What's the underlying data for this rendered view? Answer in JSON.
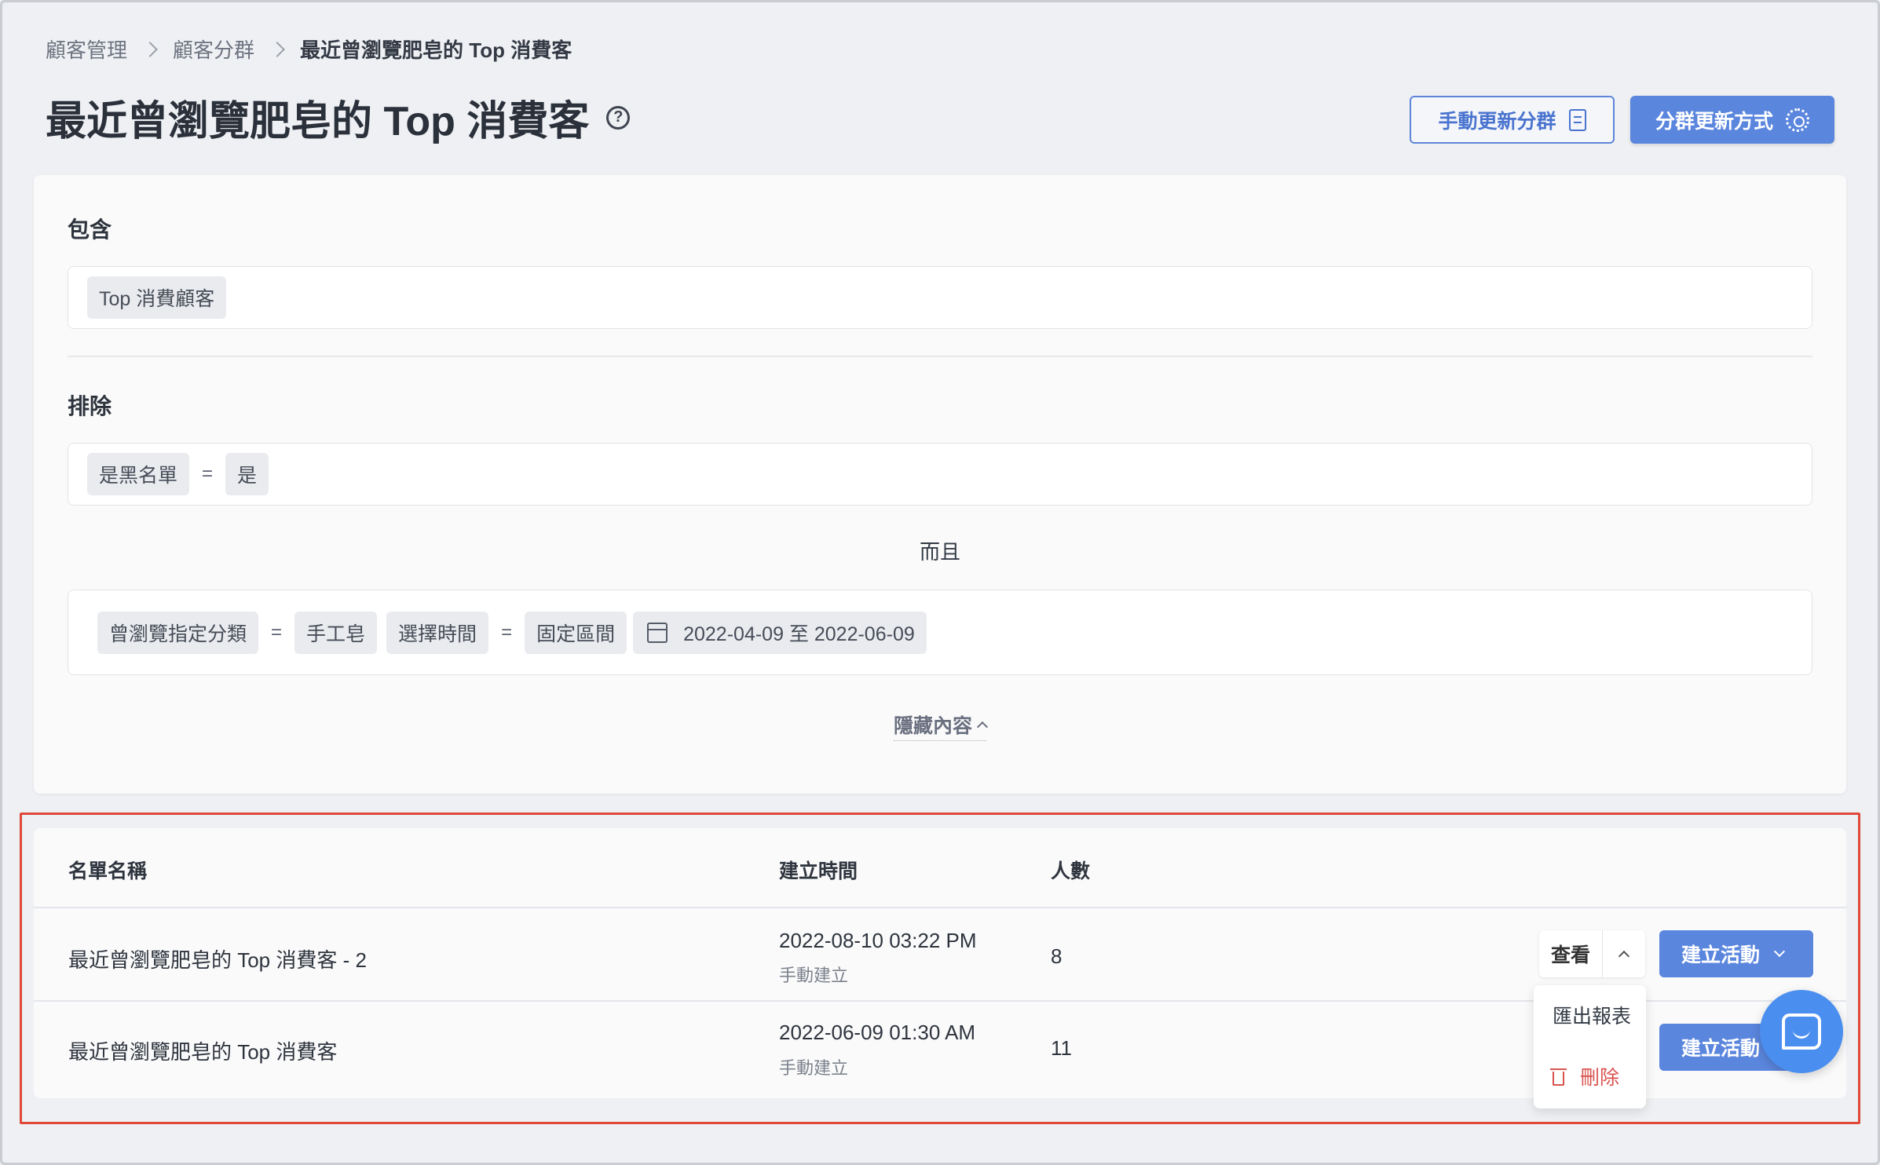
{
  "breadcrumb": {
    "items": [
      "顧客管理",
      "顧客分群"
    ],
    "current": "最近曾瀏覽肥皂的 Top 消費客"
  },
  "page_title": "最近曾瀏覽肥皂的 Top 消費客",
  "header_buttons": {
    "manual_update": "手動更新分群",
    "update_method": "分群更新方式"
  },
  "include": {
    "label": "包含",
    "chips": [
      "Top 消費顧客"
    ]
  },
  "exclude": {
    "label": "排除",
    "condition1": {
      "field": "是黑名單",
      "operator": "=",
      "value": "是"
    },
    "joiner": "而且",
    "condition2": {
      "field": "曾瀏覽指定分類",
      "operator1": "=",
      "value": "手工皂",
      "time_field": "選擇時間",
      "operator2": "=",
      "time_type": "固定區間",
      "date_range": "2022-04-09 至 2022-06-09"
    }
  },
  "hide_toggle": "隱藏內容",
  "table": {
    "headers": {
      "name": "名單名稱",
      "created": "建立時間",
      "count": "人數"
    },
    "rows": [
      {
        "name": "最近曾瀏覽肥皂的 Top 消費客 - 2",
        "created": "2022-08-10 03:22 PM",
        "source": "手動建立",
        "count": "8"
      },
      {
        "name": "最近曾瀏覽肥皂的 Top 消費客",
        "created": "2022-06-09 01:30 AM",
        "source": "手動建立",
        "count": "11"
      }
    ],
    "view_label": "查看",
    "create_label": "建立活動"
  },
  "dropdown": {
    "export": "匯出報表",
    "delete": "刪除"
  },
  "colors": {
    "primary": "#5b86de",
    "highlight": "#e0493a",
    "danger": "#d9534f",
    "chat": "#4a8ef0"
  }
}
